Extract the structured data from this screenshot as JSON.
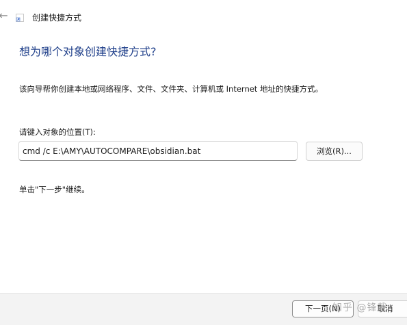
{
  "window": {
    "title": "创建快捷方式",
    "back_icon": "arrow-left-icon",
    "wizard_icon": "shortcut-icon"
  },
  "main": {
    "heading": "想为哪个对象创建快捷方式?",
    "description": "该向导帮你创建本地或网络程序、文件、文件夹、计算机或 Internet 地址的快捷方式。",
    "location_label": "请键入对象的位置(T):",
    "location_value": "cmd /c E:\\AMY\\AUTOCOMPARE\\obsidian.bat",
    "browse_label": "浏览(R)...",
    "next_hint": "单击\"下一步\"继续。"
  },
  "footer": {
    "next_label": "下一页(N)",
    "cancel_label": "取消"
  },
  "watermark": {
    "text": "知乎 @锋哉"
  }
}
